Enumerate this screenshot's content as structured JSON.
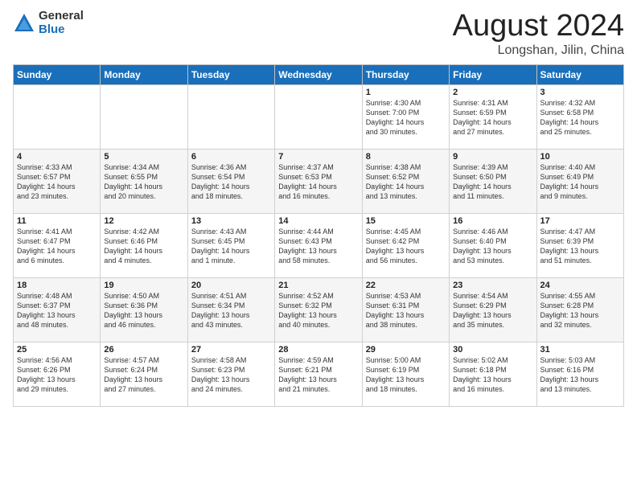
{
  "header": {
    "logo": {
      "general": "General",
      "blue": "Blue"
    },
    "title": "August 2024",
    "location": "Longshan, Jilin, China"
  },
  "days_of_week": [
    "Sunday",
    "Monday",
    "Tuesday",
    "Wednesday",
    "Thursday",
    "Friday",
    "Saturday"
  ],
  "weeks": [
    {
      "row_class": "row-odd",
      "days": [
        {
          "num": "",
          "info": "",
          "empty": true
        },
        {
          "num": "",
          "info": "",
          "empty": true
        },
        {
          "num": "",
          "info": "",
          "empty": true
        },
        {
          "num": "",
          "info": "",
          "empty": true
        },
        {
          "num": "1",
          "info": "Sunrise: 4:30 AM\nSunset: 7:00 PM\nDaylight: 14 hours\nand 30 minutes."
        },
        {
          "num": "2",
          "info": "Sunrise: 4:31 AM\nSunset: 6:59 PM\nDaylight: 14 hours\nand 27 minutes."
        },
        {
          "num": "3",
          "info": "Sunrise: 4:32 AM\nSunset: 6:58 PM\nDaylight: 14 hours\nand 25 minutes."
        }
      ]
    },
    {
      "row_class": "row-even",
      "days": [
        {
          "num": "4",
          "info": "Sunrise: 4:33 AM\nSunset: 6:57 PM\nDaylight: 14 hours\nand 23 minutes."
        },
        {
          "num": "5",
          "info": "Sunrise: 4:34 AM\nSunset: 6:55 PM\nDaylight: 14 hours\nand 20 minutes."
        },
        {
          "num": "6",
          "info": "Sunrise: 4:36 AM\nSunset: 6:54 PM\nDaylight: 14 hours\nand 18 minutes."
        },
        {
          "num": "7",
          "info": "Sunrise: 4:37 AM\nSunset: 6:53 PM\nDaylight: 14 hours\nand 16 minutes."
        },
        {
          "num": "8",
          "info": "Sunrise: 4:38 AM\nSunset: 6:52 PM\nDaylight: 14 hours\nand 13 minutes."
        },
        {
          "num": "9",
          "info": "Sunrise: 4:39 AM\nSunset: 6:50 PM\nDaylight: 14 hours\nand 11 minutes."
        },
        {
          "num": "10",
          "info": "Sunrise: 4:40 AM\nSunset: 6:49 PM\nDaylight: 14 hours\nand 9 minutes."
        }
      ]
    },
    {
      "row_class": "row-odd",
      "days": [
        {
          "num": "11",
          "info": "Sunrise: 4:41 AM\nSunset: 6:47 PM\nDaylight: 14 hours\nand 6 minutes."
        },
        {
          "num": "12",
          "info": "Sunrise: 4:42 AM\nSunset: 6:46 PM\nDaylight: 14 hours\nand 4 minutes."
        },
        {
          "num": "13",
          "info": "Sunrise: 4:43 AM\nSunset: 6:45 PM\nDaylight: 14 hours\nand 1 minute."
        },
        {
          "num": "14",
          "info": "Sunrise: 4:44 AM\nSunset: 6:43 PM\nDaylight: 13 hours\nand 58 minutes."
        },
        {
          "num": "15",
          "info": "Sunrise: 4:45 AM\nSunset: 6:42 PM\nDaylight: 13 hours\nand 56 minutes."
        },
        {
          "num": "16",
          "info": "Sunrise: 4:46 AM\nSunset: 6:40 PM\nDaylight: 13 hours\nand 53 minutes."
        },
        {
          "num": "17",
          "info": "Sunrise: 4:47 AM\nSunset: 6:39 PM\nDaylight: 13 hours\nand 51 minutes."
        }
      ]
    },
    {
      "row_class": "row-even",
      "days": [
        {
          "num": "18",
          "info": "Sunrise: 4:48 AM\nSunset: 6:37 PM\nDaylight: 13 hours\nand 48 minutes."
        },
        {
          "num": "19",
          "info": "Sunrise: 4:50 AM\nSunset: 6:36 PM\nDaylight: 13 hours\nand 46 minutes."
        },
        {
          "num": "20",
          "info": "Sunrise: 4:51 AM\nSunset: 6:34 PM\nDaylight: 13 hours\nand 43 minutes."
        },
        {
          "num": "21",
          "info": "Sunrise: 4:52 AM\nSunset: 6:32 PM\nDaylight: 13 hours\nand 40 minutes."
        },
        {
          "num": "22",
          "info": "Sunrise: 4:53 AM\nSunset: 6:31 PM\nDaylight: 13 hours\nand 38 minutes."
        },
        {
          "num": "23",
          "info": "Sunrise: 4:54 AM\nSunset: 6:29 PM\nDaylight: 13 hours\nand 35 minutes."
        },
        {
          "num": "24",
          "info": "Sunrise: 4:55 AM\nSunset: 6:28 PM\nDaylight: 13 hours\nand 32 minutes."
        }
      ]
    },
    {
      "row_class": "row-odd",
      "days": [
        {
          "num": "25",
          "info": "Sunrise: 4:56 AM\nSunset: 6:26 PM\nDaylight: 13 hours\nand 29 minutes."
        },
        {
          "num": "26",
          "info": "Sunrise: 4:57 AM\nSunset: 6:24 PM\nDaylight: 13 hours\nand 27 minutes."
        },
        {
          "num": "27",
          "info": "Sunrise: 4:58 AM\nSunset: 6:23 PM\nDaylight: 13 hours\nand 24 minutes."
        },
        {
          "num": "28",
          "info": "Sunrise: 4:59 AM\nSunset: 6:21 PM\nDaylight: 13 hours\nand 21 minutes."
        },
        {
          "num": "29",
          "info": "Sunrise: 5:00 AM\nSunset: 6:19 PM\nDaylight: 13 hours\nand 18 minutes."
        },
        {
          "num": "30",
          "info": "Sunrise: 5:02 AM\nSunset: 6:18 PM\nDaylight: 13 hours\nand 16 minutes."
        },
        {
          "num": "31",
          "info": "Sunrise: 5:03 AM\nSunset: 6:16 PM\nDaylight: 13 hours\nand 13 minutes."
        }
      ]
    }
  ]
}
